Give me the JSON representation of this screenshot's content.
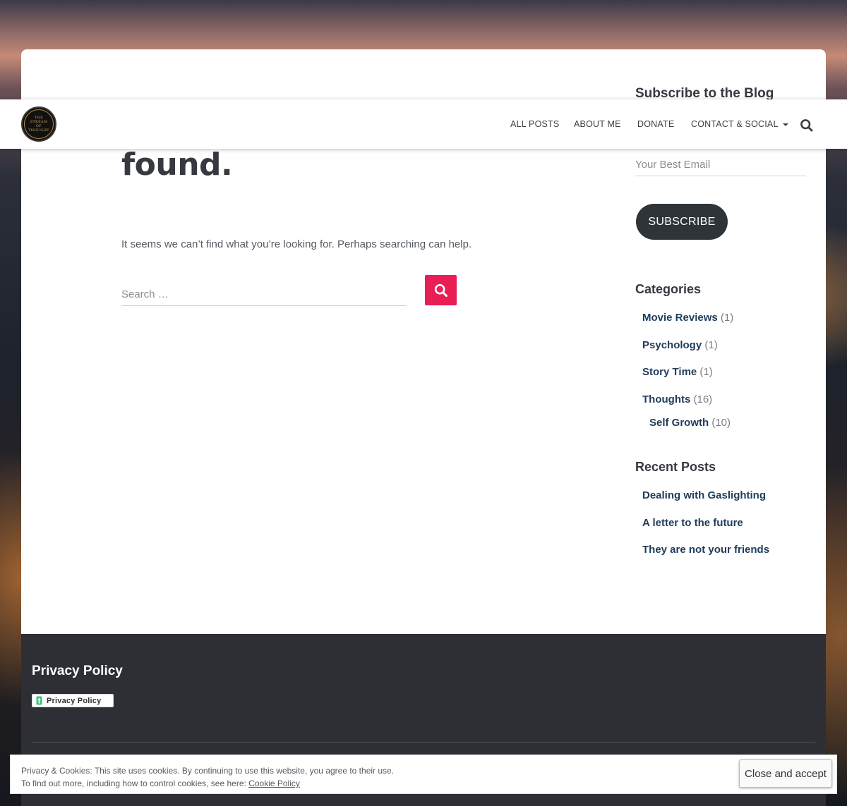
{
  "header": {
    "logo_text": "THE STREAM OF THOUGHT",
    "nav": [
      {
        "label": "ALL POSTS"
      },
      {
        "label": "ABOUT ME"
      },
      {
        "label": "DONATE"
      },
      {
        "label": "CONTACT & SOCIAL"
      }
    ]
  },
  "main": {
    "title": "found.",
    "message": "It seems we can’t find what you’re looking for. Perhaps searching can help.",
    "search_placeholder": "Search …"
  },
  "sidebar": {
    "subscribe_title": "Subscribe to the Blog",
    "email_placeholder": "Your Best Email",
    "subscribe_label": "SUBSCRIBE",
    "categories_title": "Categories",
    "categories": [
      {
        "name": "Movie Reviews",
        "count": "(1)"
      },
      {
        "name": "Psychology",
        "count": "(1)"
      },
      {
        "name": "Story Time",
        "count": "(1)"
      },
      {
        "name": "Thoughts",
        "count": "(16)"
      },
      {
        "name": "Self Growth",
        "count": "(10)"
      }
    ],
    "recent_title": "Recent Posts",
    "recent_posts": [
      {
        "title": "Dealing with Gaslighting"
      },
      {
        "title": "A letter to the future"
      },
      {
        "title": "They are not your friends"
      }
    ]
  },
  "footer": {
    "title": "Privacy Policy",
    "badge_label": "Privacy Policy"
  },
  "cookie": {
    "line1": "Privacy & Cookies: This site uses cookies. By continuing to use this website, you agree to their use.",
    "line2_prefix": "To find out more, including how to control cookies, see here: ",
    "link_label": "Cookie Policy",
    "button_label": "Close and accept"
  },
  "colors": {
    "accent": "#e91e55",
    "link": "#1f3c5a",
    "footer_bg": "#2d2f34",
    "button_dark": "#2f3438"
  }
}
